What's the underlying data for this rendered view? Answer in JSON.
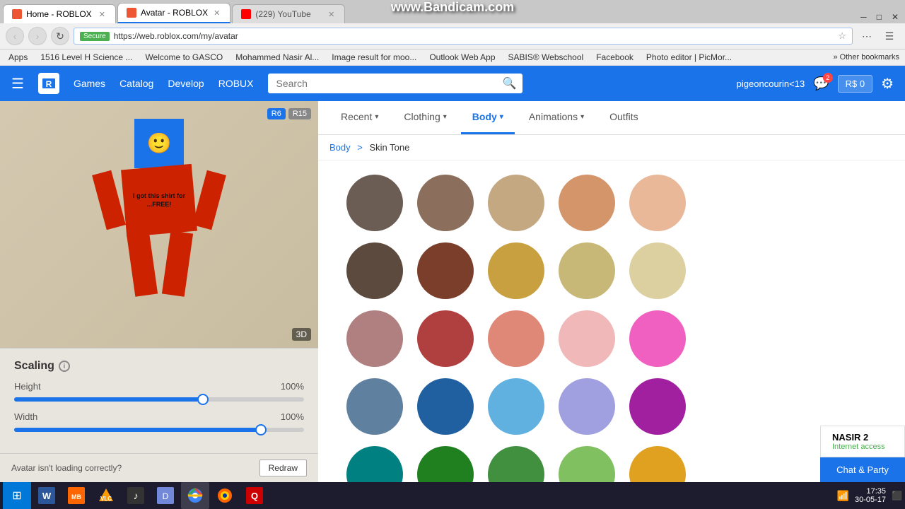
{
  "bandicam": "www.Bandicam.com",
  "browser": {
    "tabs": [
      {
        "id": "tab-home",
        "label": "Home - ROBLOX",
        "favicon_type": "roblox",
        "active": false
      },
      {
        "id": "tab-avatar",
        "label": "Avatar - ROBLOX",
        "favicon_type": "roblox",
        "active": true
      },
      {
        "id": "tab-youtube",
        "label": "(229) YouTube",
        "favicon_type": "youtube",
        "active": false
      }
    ],
    "address": "https://web.roblox.com/my/avatar",
    "secure_label": "Secure"
  },
  "bookmarks": [
    "Apps",
    "1516 Level H Science ...",
    "Welcome to GASCO",
    "Mohammed Nasir Al...",
    "Image result for moo...",
    "Outlook Web App",
    "SABIS® Webschool",
    "Facebook",
    "Photo editor | PicMor..."
  ],
  "nav": {
    "hamburger": "☰",
    "logo": "R",
    "links": [
      "Games",
      "Catalog",
      "Develop",
      "ROBUX"
    ],
    "search_placeholder": "Search",
    "username": "pigeoncourin<13",
    "robux_label": "R$ 0",
    "chat_label": "Chat &",
    "chat_party": "Party"
  },
  "avatar": {
    "badge_r6": "R6",
    "badge_r15": "R15",
    "label_3d": "3D",
    "shirt_text": "I got this shirt for ...FREE!",
    "scaling_title": "Scaling",
    "height_label": "Height",
    "height_value": "100%",
    "height_percent": 65,
    "width_label": "Width",
    "width_value": "100%",
    "width_percent": 85,
    "loading_text": "Avatar isn't loading correctly?",
    "redraw_label": "Redraw"
  },
  "category_tabs": [
    {
      "id": "recent",
      "label": "Recent",
      "has_arrow": true,
      "active": false
    },
    {
      "id": "clothing",
      "label": "Clothing",
      "has_arrow": true,
      "active": false
    },
    {
      "id": "body",
      "label": "Body",
      "has_arrow": true,
      "active": true
    },
    {
      "id": "animations",
      "label": "Animations",
      "has_arrow": true,
      "active": false
    },
    {
      "id": "outfits",
      "label": "Outfits",
      "has_arrow": false,
      "active": false
    }
  ],
  "breadcrumb": {
    "parent": "Body",
    "separator": ">",
    "current": "Skin Tone"
  },
  "skin_tones": {
    "rows": [
      [
        {
          "color": "#6b5c54",
          "id": "c1"
        },
        {
          "color": "#8b6f5c",
          "id": "c2"
        },
        {
          "color": "#c4a882",
          "id": "c3"
        },
        {
          "color": "#d4956a",
          "id": "c4"
        },
        {
          "color": "#e8b898",
          "id": "c5"
        }
      ],
      [
        {
          "color": "#5c4a3e",
          "id": "c6"
        },
        {
          "color": "#7a3e2a",
          "id": "c7"
        },
        {
          "color": "#c8a040",
          "id": "c8"
        },
        {
          "color": "#c8b878",
          "id": "c9"
        },
        {
          "color": "#ddd0a0",
          "id": "c10"
        }
      ],
      [
        {
          "color": "#b08080",
          "id": "c11"
        },
        {
          "color": "#b04040",
          "id": "c12"
        },
        {
          "color": "#e08878",
          "id": "c13"
        },
        {
          "color": "#f0b8b8",
          "id": "c14"
        },
        {
          "color": "#f060c0",
          "id": "c15"
        }
      ],
      [
        {
          "color": "#6080a0",
          "id": "c16"
        },
        {
          "color": "#2060a0",
          "id": "c17"
        },
        {
          "color": "#60b0e0",
          "id": "c18"
        },
        {
          "color": "#a0a0e0",
          "id": "c19"
        },
        {
          "color": "#a020a0",
          "id": "c20"
        }
      ],
      [
        {
          "color": "#008080",
          "id": "c21"
        },
        {
          "color": "#208020",
          "id": "c22"
        },
        {
          "color": "#409040",
          "id": "c23"
        },
        {
          "color": "#80c060",
          "id": "c24"
        },
        {
          "color": "#e0a020",
          "id": "c25"
        }
      ]
    ]
  },
  "chat_widget": {
    "label": "Chat & Party",
    "user": "NASIR  2",
    "status": "Internet access"
  },
  "taskbar": {
    "time": "17:35",
    "date": "30-05-17",
    "apps": [
      "⊞",
      "W",
      "MB",
      "VLC",
      "🎵",
      "💬",
      "🌐",
      "🔥",
      "Q"
    ]
  }
}
